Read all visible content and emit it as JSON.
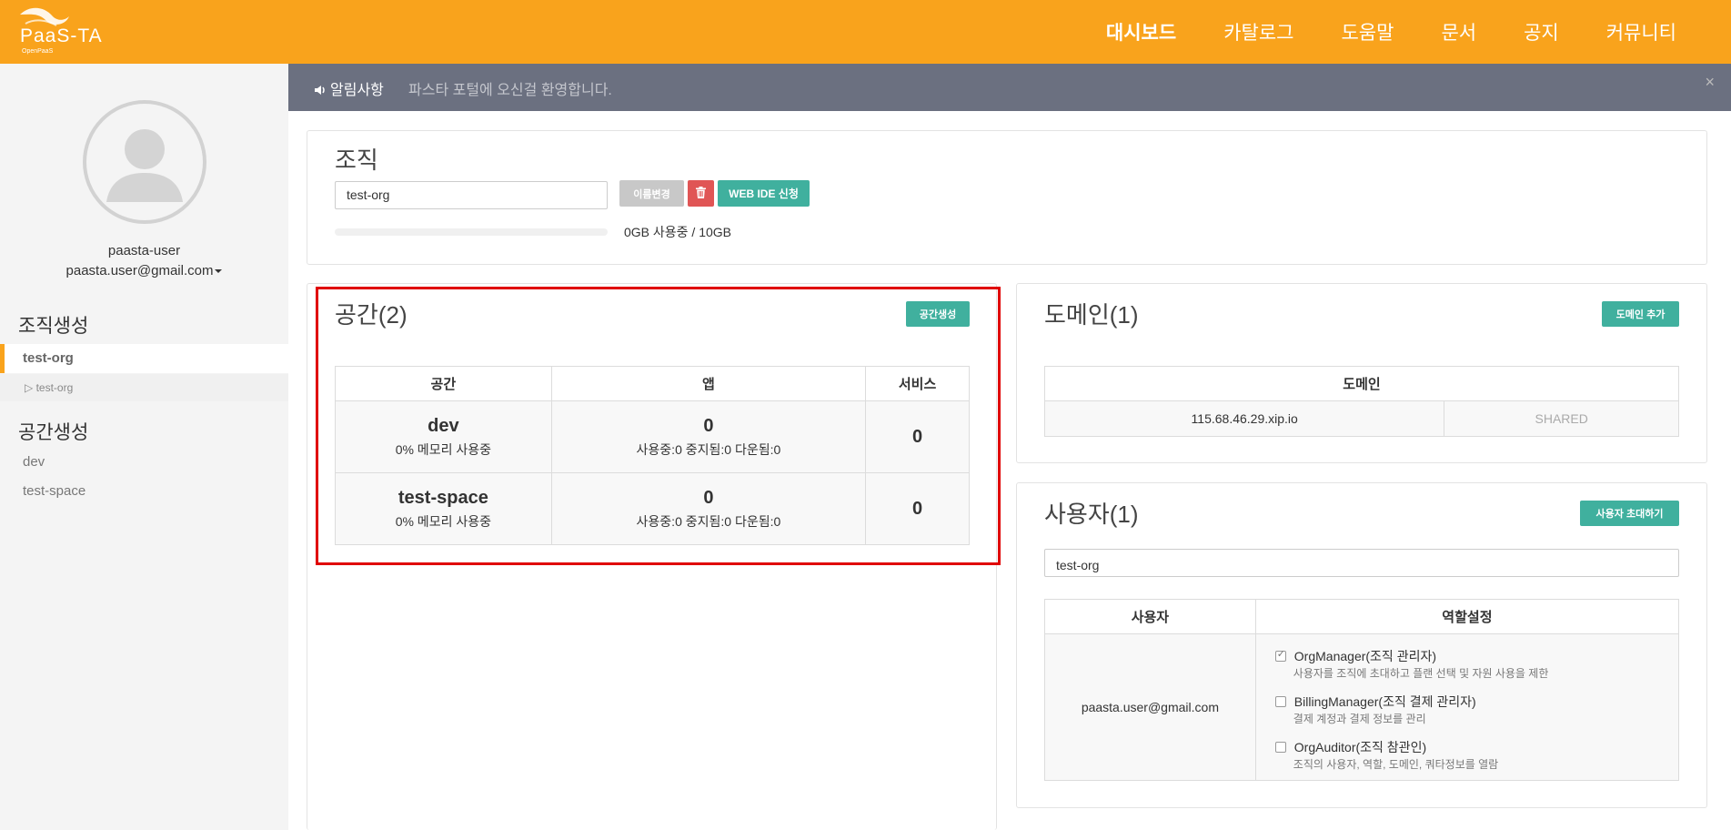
{
  "brand": {
    "name": "PaaS-TA",
    "sub": "OpenPaaS"
  },
  "nav": [
    {
      "label": "대시보드",
      "active": true
    },
    {
      "label": "카탈로그"
    },
    {
      "label": "도움말"
    },
    {
      "label": "문서"
    },
    {
      "label": "공지"
    },
    {
      "label": "커뮤니티"
    }
  ],
  "sidebar": {
    "user_name": "paasta-user",
    "user_email": "paasta.user@gmail.com",
    "org_section": "조직생성",
    "org_active": "test-org",
    "org_sub": "▷ test-org",
    "space_section": "공간생성",
    "spaces": [
      "dev",
      "test-space"
    ]
  },
  "notice": {
    "label": "알림사항",
    "text": "파스타 포털에 오신걸 환영합니다.",
    "close": "×"
  },
  "org_panel": {
    "title": "조직",
    "org_name": "test-org",
    "rename_label": "이름변경",
    "webide_label": "WEB IDE 신청",
    "usage_text": "0GB 사용중 / 10GB",
    "usage_fraction": 0
  },
  "space_panel": {
    "title": "공간(2)",
    "create_label": "공간생성",
    "headers": [
      "공간",
      "앱",
      "서비스"
    ],
    "rows": [
      {
        "name": "dev",
        "memory": "0% 메모리 사용중",
        "apps": "0",
        "app_status": "사용중:0 중지됨:0 다운됨:0",
        "services": "0"
      },
      {
        "name": "test-space",
        "memory": "0% 메모리 사용중",
        "apps": "0",
        "app_status": "사용중:0 중지됨:0 다운됨:0",
        "services": "0"
      }
    ]
  },
  "domain_panel": {
    "title": "도메인(1)",
    "add_label": "도메인 추가",
    "header": "도메인",
    "rows": [
      {
        "domain": "115.68.46.29.xip.io",
        "type": "SHARED"
      }
    ]
  },
  "user_panel": {
    "title": "사용자(1)",
    "invite_label": "사용자 초대하기",
    "filter_value": "test-org",
    "headers": [
      "사용자",
      "역할설정"
    ],
    "user": "paasta.user@gmail.com",
    "roles": [
      {
        "name": "OrgManager(조직 관리자)",
        "desc": "사용자를 조직에 초대하고 플랜 선택 및 자원 사용을 제한",
        "checked": true
      },
      {
        "name": "BillingManager(조직 결제 관리자)",
        "desc": "결제 계정과 결제 정보를 관리",
        "checked": false
      },
      {
        "name": "OrgAuditor(조직 참관인)",
        "desc": "조직의 사용자, 역할, 도메인, 쿼타정보를 열람",
        "checked": false
      }
    ]
  }
}
